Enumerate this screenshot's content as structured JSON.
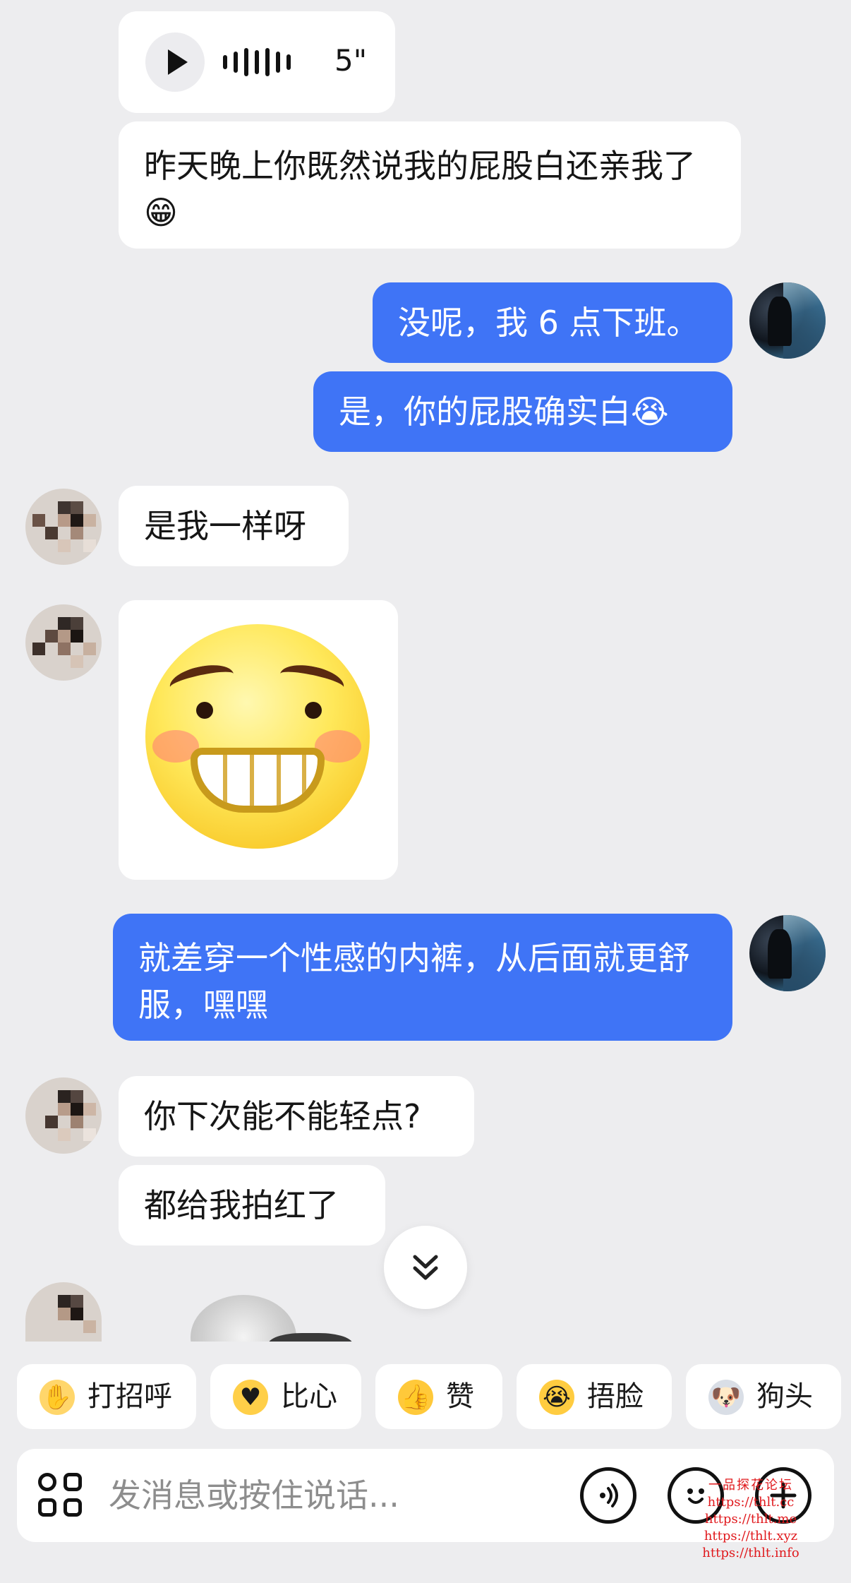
{
  "messages": [
    {
      "id": "voice",
      "duration": "5\""
    },
    {
      "id": "m1",
      "text": "昨天晚上你既然说我的屁股白还亲我了😁"
    },
    {
      "id": "m2",
      "text": "没呢，我 6 点下班。"
    },
    {
      "id": "m3",
      "text": "是，你的屁股确实白😭"
    },
    {
      "id": "m4",
      "text": "是我一样呀"
    },
    {
      "id": "m5",
      "text": "就差穿一个性感的内裤，从后面就更舒服，嘿嘿"
    },
    {
      "id": "m6",
      "text": "你下次能不能轻点?"
    },
    {
      "id": "m7",
      "text": "都给我拍红了"
    }
  ],
  "scroll_down_icon": "double-chevron-down-icon",
  "quick_replies": [
    {
      "label": "打招呼",
      "icon": "wave-hand-emoji-icon"
    },
    {
      "label": "比心",
      "icon": "finger-heart-emoji-icon"
    },
    {
      "label": "赞",
      "icon": "thumbs-up-emoji-icon"
    },
    {
      "label": "捂脸",
      "icon": "facepalm-emoji-icon"
    },
    {
      "label": "狗头",
      "icon": "doge-emoji-icon"
    }
  ],
  "composer": {
    "placeholder": "发消息或按住说话...",
    "apps_icon": "apps-grid-icon",
    "voice_icon": "voice-wave-icon",
    "emoji_icon": "emoji-face-icon",
    "plus_icon": "plus-icon"
  },
  "watermark": {
    "title": "一品探花论坛",
    "urls": [
      "https://thlt.cc",
      "https://thlt.me",
      "https://thlt.xyz",
      "https://thlt.info"
    ]
  },
  "colors": {
    "self_bubble": "#3f74f6",
    "background": "#ededef"
  }
}
